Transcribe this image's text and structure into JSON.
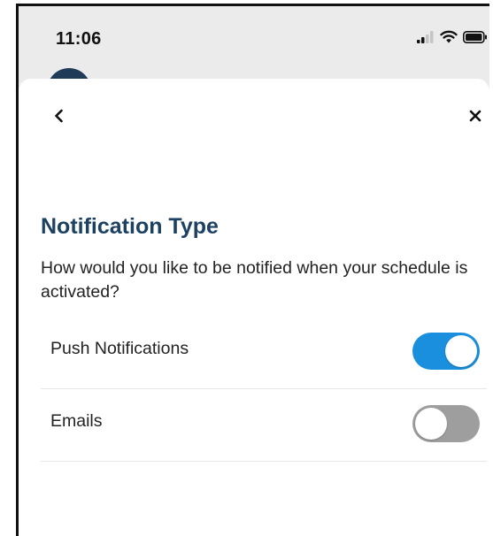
{
  "status_bar": {
    "time": "11:06",
    "icons": [
      "signal-icon",
      "wifi-icon",
      "battery-icon"
    ]
  },
  "header": {
    "back_icon": "chevron-left-icon",
    "close_icon": "close-icon"
  },
  "content": {
    "title": "Notification Type",
    "description": "How would you like to be notified when your schedule is activated?",
    "options": [
      {
        "label": "Push Notifications",
        "enabled": true
      },
      {
        "label": "Emails",
        "enabled": false
      }
    ]
  },
  "colors": {
    "title": "#1d4162",
    "toggle_on": "#1a8fdd",
    "toggle_off": "#9e9e9e"
  }
}
